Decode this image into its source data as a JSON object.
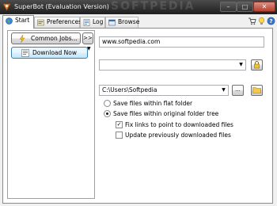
{
  "window": {
    "title": "SuperBot (Evaluation Version)",
    "watermark": "SOFTPEDIA",
    "min_glyph": "–",
    "max_glyph": "□",
    "close_glyph": "✕"
  },
  "tabs": [
    {
      "label": "Start",
      "icon": "globe-icon",
      "active": true
    },
    {
      "label": "Preferences",
      "icon": "preferences-icon",
      "active": false
    },
    {
      "label": "Log",
      "icon": "log-icon",
      "active": false
    },
    {
      "label": "Browse",
      "icon": "browse-icon",
      "active": false
    }
  ],
  "toolbar_icons": [
    "cart-icon",
    "lightbulb-icon",
    "help-icon"
  ],
  "sidebar": {
    "common_jobs_label": "Common Jobs...",
    "more_label": ">>",
    "download_now_label": "Download Now",
    "download_dropdown_glyph": "▼"
  },
  "main": {
    "url_value": "www.softpedia.com",
    "combo1_value": "",
    "combo_arrow_glyph": "▼",
    "folder_value": "C:\\Users\\Softpedia",
    "browse_label": "...",
    "options": {
      "flat_label": "Save files within flat folder",
      "flat_selected": false,
      "tree_label": "Save files within original folder tree",
      "tree_selected": true,
      "fix_links_label": "Fix links to point to downloaded files",
      "fix_links_checked": true,
      "update_label": "Update previously downloaded files",
      "update_checked": false,
      "check_glyph": "✓"
    }
  },
  "colors": {
    "titlebar": "#2b2b2b",
    "close_button": "#c75a47",
    "accent_blue": "#3c7fb1"
  }
}
